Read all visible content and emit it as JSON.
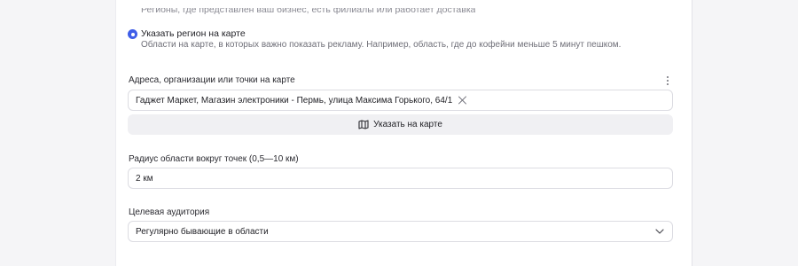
{
  "region_section": {
    "clipped_line": "Регионы, где представлен ваш бизнес, есть филиалы или работает доставка",
    "option_label": "Указать регион на карте",
    "option_description": "Области на карте, в которых важно показать рекламу. Например, область, где до кофейни меньше 5 минут пешком."
  },
  "addresses": {
    "label": "Адреса, организации или точки на карте",
    "chip_text": "Гаджет Маркет, Магазин электроники - Пермь, улица Максима Горького, 64/1",
    "map_button_label": "Указать на карте"
  },
  "radius": {
    "label": "Радиус области вокруг точек (0,5—10 км)",
    "value": "2 км"
  },
  "audience": {
    "label": "Целевая аудитория",
    "selected": "Регулярно бывающие в области"
  },
  "colors": {
    "accent": "#3f5ee8",
    "field_border": "#dcdce2",
    "button_bg": "#f0f0f3"
  },
  "icons": [
    "close-icon",
    "map-icon",
    "chevron-down-icon",
    "more-vertical-icon"
  ]
}
